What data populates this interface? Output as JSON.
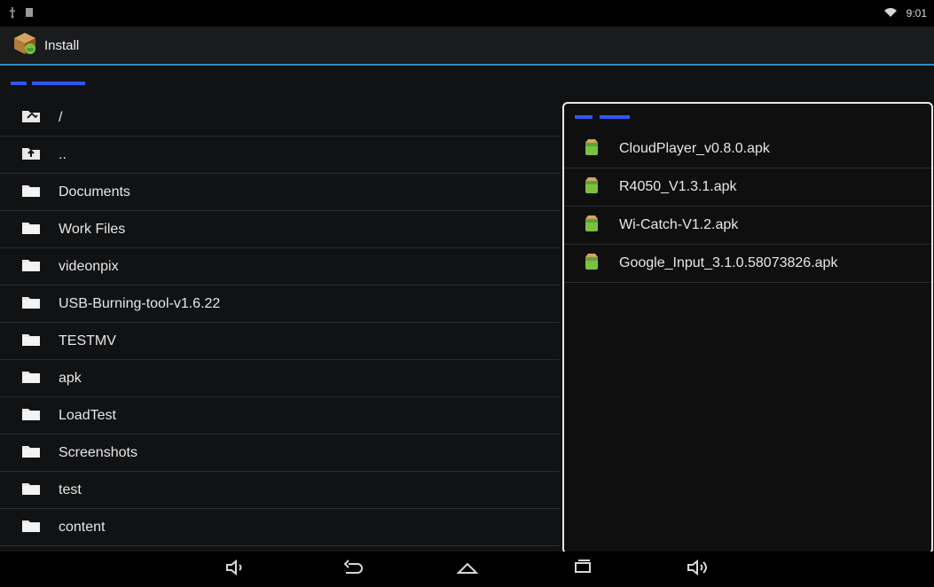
{
  "status": {
    "time": "9:01"
  },
  "app": {
    "title": "Install"
  },
  "file_list": [
    {
      "name": "/",
      "icon": "folder-root-icon"
    },
    {
      "name": "..",
      "icon": "folder-up-icon"
    },
    {
      "name": "Documents",
      "icon": "folder-icon"
    },
    {
      "name": "Work Files",
      "icon": "folder-icon"
    },
    {
      "name": "videonpix",
      "icon": "folder-icon"
    },
    {
      "name": "USB-Burning-tool-v1.6.22",
      "icon": "folder-icon"
    },
    {
      "name": "TESTMV",
      "icon": "folder-icon"
    },
    {
      "name": "apk",
      "icon": "folder-icon"
    },
    {
      "name": "LoadTest",
      "icon": "folder-icon"
    },
    {
      "name": "Screenshots",
      "icon": "folder-icon"
    },
    {
      "name": "test",
      "icon": "folder-icon"
    },
    {
      "name": "content",
      "icon": "folder-icon"
    }
  ],
  "popup": {
    "apks": [
      {
        "name": "CloudPlayer_v0.8.0.apk"
      },
      {
        "name": "R4050_V1.3.1.apk"
      },
      {
        "name": "Wi-Catch-V1.2.apk"
      },
      {
        "name": "Google_Input_3.1.0.58073826.apk"
      }
    ]
  },
  "nav": {
    "icons": [
      "volume-down-icon",
      "back-icon",
      "home-icon",
      "recents-icon",
      "volume-up-icon"
    ]
  },
  "colors": {
    "accent_blue": "#2b8cc4",
    "path_blue": "#2f56ff",
    "apk_green": "#7ac143"
  }
}
